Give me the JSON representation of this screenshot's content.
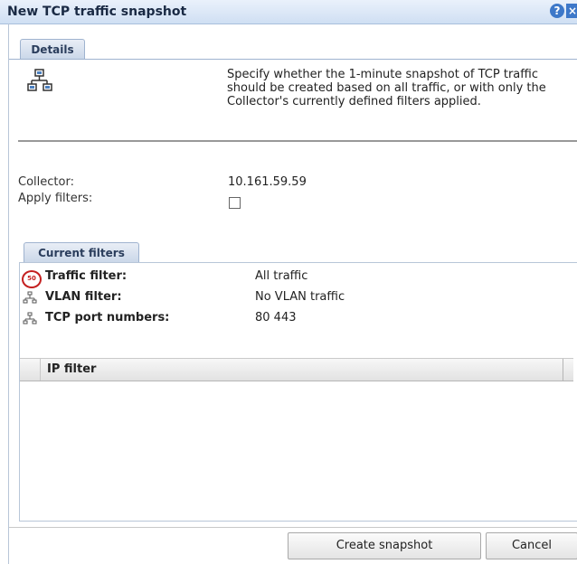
{
  "dialog": {
    "title": "New TCP traffic snapshot"
  },
  "icons": {
    "help": "help-icon",
    "close": "close-icon",
    "network": "network-icon",
    "stop": "stop-sign-icon",
    "vlan": "network-small-icon",
    "tcp": "network-small-icon"
  },
  "tabs": {
    "details": "Details",
    "current_filters": "Current filters"
  },
  "intro": "Specify whether the 1-minute snapshot of TCP traffic should be created based on all traffic, or with only the Collector's currently defined filters applied.",
  "fields": {
    "collector_label": "Collector:",
    "collector_value": "10.161.59.59",
    "apply_filters_label": "Apply filters:",
    "apply_filters_checked": false
  },
  "filters": [
    {
      "label": "Traffic filter:",
      "value": "All traffic"
    },
    {
      "label": "VLAN filter:",
      "value": "No VLAN traffic"
    },
    {
      "label": "TCP port numbers:",
      "value": "80 443"
    }
  ],
  "ip_table": {
    "columns": [
      "IP filter"
    ],
    "rows": []
  },
  "buttons": {
    "create": "Create snapshot",
    "cancel": "Cancel"
  }
}
